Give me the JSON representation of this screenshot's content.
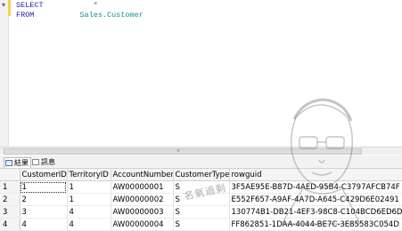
{
  "editor": {
    "line1_keyword": "SELECT",
    "line1_star": "*",
    "line2_keyword": "FROM",
    "line2_object": "Sales.Customer"
  },
  "results_tabs": {
    "results_label": "結果",
    "messages_label": "訊息"
  },
  "grid": {
    "columns": [
      "",
      "CustomerID",
      "TerritoryID",
      "AccountNumber",
      "CustomerType",
      "rowguid"
    ],
    "rows": [
      [
        "1",
        "1",
        "1",
        "AW00000001",
        "S",
        "3F5AE95E-B87D-4AED-95B4-C3797AFCB74F"
      ],
      [
        "2",
        "2",
        "1",
        "AW00000002",
        "S",
        "E552F657-A9AF-4A7D-A645-C429D6E02491"
      ],
      [
        "3",
        "3",
        "4",
        "AW00000003",
        "S",
        "130774B1-DB21-4EF3-98C8-C104BCD6ED6D"
      ],
      [
        "4",
        "4",
        "4",
        "AW00000004",
        "S",
        "FF862851-1DAA-4044-BE7C-3E85583C054D"
      ]
    ]
  },
  "watermark": {
    "text": "名氣過剩"
  },
  "colors": {
    "keyword": "#1a1ab0",
    "object": "#148c8c",
    "change_bar": "#f5d24a"
  }
}
